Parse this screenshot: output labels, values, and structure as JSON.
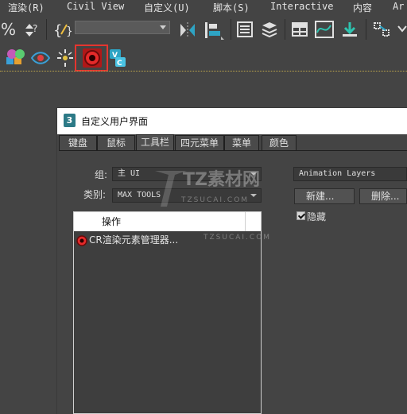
{
  "menu": {
    "items": [
      "渲染(R)",
      "Civil View",
      "自定义(U)",
      "脚本(S)",
      "Interactive",
      "内容",
      "Ar"
    ]
  },
  "toolbar": {
    "named_selection_value": "",
    "icons": [
      "percent-snap-icon",
      "spinner-snap-icon",
      "edit-named-selection-icon",
      "mirror-icon",
      "align-icon",
      "toggle-scene-explorer-icon",
      "toggle-layer-explorer-icon",
      "toggle-ribbon-icon",
      "curve-editor-icon",
      "schematic-view-icon",
      "material-editor-icon",
      "render-setup-icon",
      "rendered-frame-window-icon",
      "view-image-icon",
      "light-lister-icon",
      "cr-render-elements-manager-icon",
      "vray-converter-icon"
    ]
  },
  "dialog": {
    "title": "自定义用户界面",
    "tabs": [
      "键盘",
      "鼠标",
      "工具栏",
      "四元菜单",
      "菜单",
      "颜色"
    ],
    "active_tab": "工具栏",
    "group_label": "组:",
    "group_value": "主 UI",
    "category_label": "类别:",
    "category_value": "MAX TOOLS",
    "list_header": "操作",
    "list_items": [
      "CR渲染元素管理器..."
    ],
    "toolbar_select_value": "Animation Layers",
    "new_button": "新建...",
    "delete_button": "删除...",
    "hide_checkbox": {
      "label": "隐藏",
      "checked": true
    }
  },
  "watermark": {
    "text": "TZ素材网",
    "subtext": "TZSUCAI.COM",
    "subtext2": "TZSUCAI.COM"
  },
  "colors": {
    "accent_highlight": "#e5352f",
    "background": "#444444"
  }
}
